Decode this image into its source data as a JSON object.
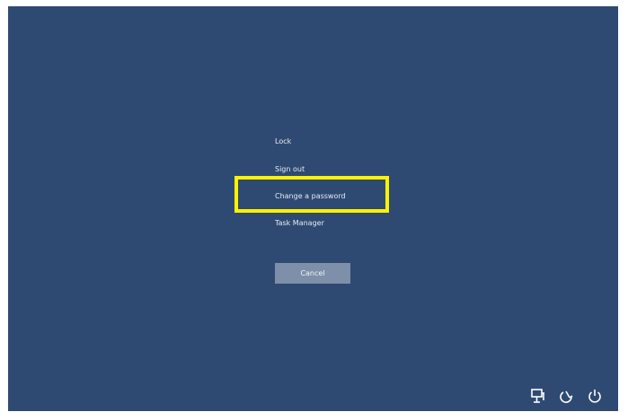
{
  "menu": {
    "items": [
      {
        "label": "Lock"
      },
      {
        "label": "Sign out"
      },
      {
        "label": "Change a password"
      },
      {
        "label": "Task Manager"
      }
    ]
  },
  "cancel_label": "Cancel",
  "tray_icons": [
    "network-icon",
    "ease-of-access-icon",
    "power-icon"
  ],
  "colors": {
    "background": "#2f4a72",
    "highlight": "#fff200",
    "button": "#7e8fa9",
    "text": "#e6ecf5"
  }
}
